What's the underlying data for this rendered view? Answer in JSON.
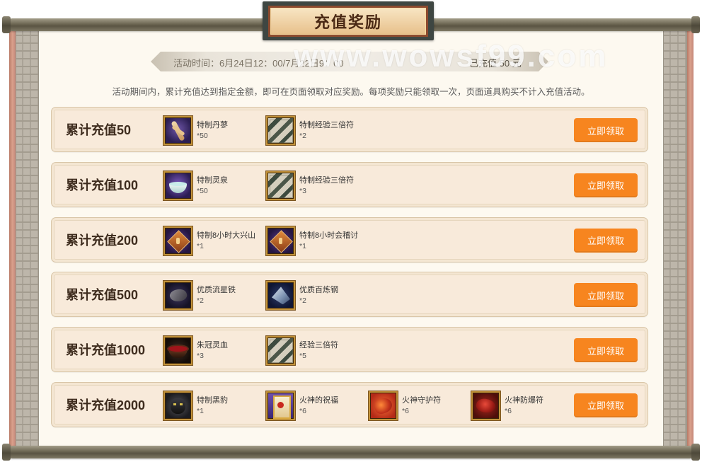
{
  "title": "充值奖励",
  "watermark": "www.wowsf99.com",
  "banner": {
    "time_text": "活动时间：6月24日12：00/7月22日9：00",
    "recharged_text": "已充值 50 元"
  },
  "description": "活动期间内，累计充值达到指定金额，即可在页面领取对应奖励。每项奖励只能领取一次，页面道具购买不计入充值活动。",
  "colors": {
    "button": "#f7851f",
    "row_bg": "#f8eada",
    "cream": "#fdf9f0",
    "label": "#3e2c1e"
  },
  "rows": [
    {
      "label": "累计充值50",
      "button_label": "立即领取",
      "items": [
        {
          "name": "特制丹蓼",
          "count": "*50",
          "icon": "herb-icon"
        },
        {
          "name": "特制经验三倍符",
          "count": "*2",
          "icon": "scroll-icon"
        }
      ]
    },
    {
      "label": "累计充值100",
      "button_label": "立即领取",
      "items": [
        {
          "name": "特制灵泉",
          "count": "*50",
          "icon": "spring-bowl-icon"
        },
        {
          "name": "特制经验三倍符",
          "count": "*3",
          "icon": "scroll-icon"
        }
      ]
    },
    {
      "label": "累计充值200",
      "button_label": "立即领取",
      "items": [
        {
          "name": "特制8小时大兴山",
          "count": "*1",
          "icon": "talisman-icon"
        },
        {
          "name": "特制8小时会稽讨",
          "count": "*1",
          "icon": "talisman-icon"
        }
      ]
    },
    {
      "label": "累计充值500",
      "button_label": "立即领取",
      "items": [
        {
          "name": "优质流星铁",
          "count": "*2",
          "icon": "meteor-iron-icon"
        },
        {
          "name": "优质百炼钢",
          "count": "*2",
          "icon": "steel-icon"
        }
      ]
    },
    {
      "label": "累计充值1000",
      "button_label": "立即领取",
      "items": [
        {
          "name": "朱冠灵血",
          "count": "*3",
          "icon": "blood-bowl-icon"
        },
        {
          "name": "经验三倍符",
          "count": "*5",
          "icon": "scroll-icon"
        }
      ]
    },
    {
      "label": "累计充值2000",
      "button_label": "立即领取",
      "items": [
        {
          "name": "特制黑豹",
          "count": "*1",
          "icon": "panther-icon"
        },
        {
          "name": "火神的祝福",
          "count": "*6",
          "icon": "blessing-icon"
        },
        {
          "name": "火神守护符",
          "count": "*6",
          "icon": "guard-charm-icon"
        },
        {
          "name": "火神防爆符",
          "count": "*6",
          "icon": "blast-charm-icon"
        }
      ]
    }
  ]
}
